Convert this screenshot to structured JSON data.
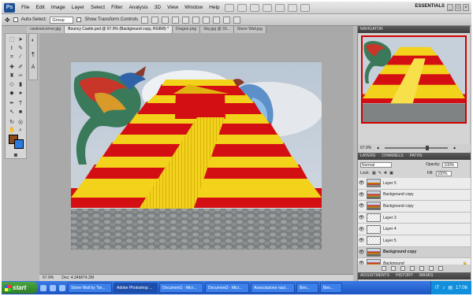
{
  "app": {
    "logo": "Ps",
    "workspace": "ESSENTIALS"
  },
  "menu": [
    "File",
    "Edit",
    "Image",
    "Layer",
    "Select",
    "Filter",
    "Analysis",
    "3D",
    "View",
    "Window",
    "Help"
  ],
  "options": {
    "auto_select_label": "Auto-Select:",
    "auto_select_value": "Group",
    "transform_label": "Show Transform Controls"
  },
  "tabs": [
    {
      "label": "castesecorner.jpg",
      "active": false
    },
    {
      "label": "Bouncy Castle.psd @ 67.9% (Background copy, RGB/8) *",
      "active": true
    },
    {
      "label": "Dragon.png",
      "active": false
    },
    {
      "label": "Sky.jpg @ 33...",
      "active": false
    },
    {
      "label": "Stone Wall.jpg",
      "active": false
    }
  ],
  "status": {
    "zoom": "67.9%",
    "doc": "Doc: 4.34M/74.2M"
  },
  "panels": {
    "navigator": "NAVIGATOR",
    "zoom": "67.9%",
    "layers_tabs": [
      "LAYERS",
      "CHANNELS",
      "PATHS"
    ],
    "blend_mode": "Normal",
    "opacity_label": "Opacity:",
    "opacity": "100%",
    "lock_label": "Lock:",
    "fill_label": "Fill:",
    "fill": "100%",
    "adjust_tabs": [
      "ADJUSTMENTS",
      "HISTORY",
      "MASKS"
    ]
  },
  "layers": [
    {
      "name": "Layer 5",
      "thumb": "ramp",
      "selected": false
    },
    {
      "name": "Background copy",
      "thumb": "pic",
      "selected": false
    },
    {
      "name": "Background copy",
      "thumb": "pic",
      "selected": false
    },
    {
      "name": "Layer 3",
      "thumb": "check",
      "selected": false
    },
    {
      "name": "Layer 4",
      "thumb": "check",
      "selected": false
    },
    {
      "name": "Layer 5",
      "thumb": "check",
      "selected": false
    },
    {
      "name": "Background copy",
      "thumb": "pic",
      "selected": true
    },
    {
      "name": "Background",
      "thumb": "pic",
      "selected": false
    }
  ],
  "taskbar": {
    "start": "start",
    "items": [
      {
        "label": "Stone Wall by \"be...",
        "active": false
      },
      {
        "label": "Adobe Photoshop ...",
        "active": true
      },
      {
        "label": "Document1 - Micr...",
        "active": false
      },
      {
        "label": "Document2 - Micr...",
        "active": false
      },
      {
        "label": "Associazione nazi...",
        "active": false
      },
      {
        "label": "Ben...",
        "active": false
      },
      {
        "label": "Ben...",
        "active": false
      }
    ],
    "tray_lang": "IT",
    "clock": "17:06"
  },
  "colors": {
    "foreground": "#8a4a1a",
    "background": "#2a7be0",
    "pyramid_red": "#d40f14",
    "pyramid_yellow": "#f2d21a"
  }
}
